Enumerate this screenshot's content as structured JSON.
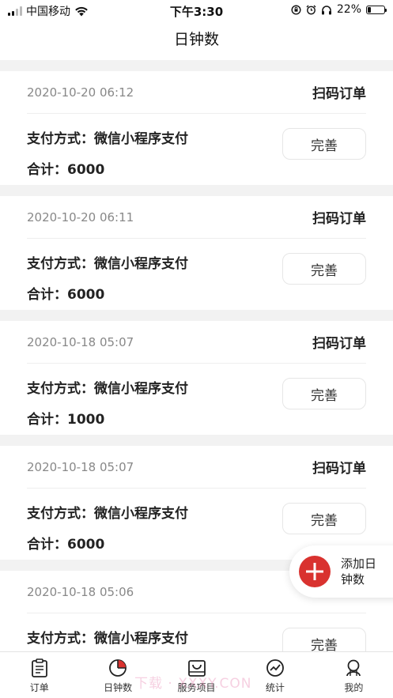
{
  "status_bar": {
    "carrier": "中国移动",
    "time": "下午3:30",
    "battery": "22%",
    "battery_level": 0.22
  },
  "header": {
    "title": "日钟数"
  },
  "orders": [
    {
      "time": "2020-10-20 06:12",
      "type": "扫码订单",
      "payment": "支付方式：微信小程序支付",
      "total": "合计：6000",
      "action": "完善"
    },
    {
      "time": "2020-10-20 06:11",
      "type": "扫码订单",
      "payment": "支付方式：微信小程序支付",
      "total": "合计：6000",
      "action": "完善"
    },
    {
      "time": "2020-10-18 05:07",
      "type": "扫码订单",
      "payment": "支付方式：微信小程序支付",
      "total": "合计：1000",
      "action": "完善"
    },
    {
      "time": "2020-10-18 05:07",
      "type": "扫码订单",
      "payment": "支付方式：微信小程序支付",
      "total": "合计：6000",
      "action": "完善"
    },
    {
      "time": "2020-10-18 05:06",
      "type": "",
      "payment": "支付方式：微信小程序支付",
      "total": "",
      "action": "完善"
    }
  ],
  "fab": {
    "label": "添加日钟数"
  },
  "tabs": [
    {
      "label": "订单",
      "icon": "order-list-icon"
    },
    {
      "label": "日钟数",
      "icon": "pie-chart-icon",
      "active": true
    },
    {
      "label": "服务项目",
      "icon": "shopping-bag-icon"
    },
    {
      "label": "统计",
      "icon": "trend-chart-icon"
    },
    {
      "label": "我的",
      "icon": "user-icon"
    }
  ],
  "watermark": "下载 · XXXY.CON",
  "colors": {
    "accent": "#d9322f",
    "background": "#f2f2f2"
  }
}
